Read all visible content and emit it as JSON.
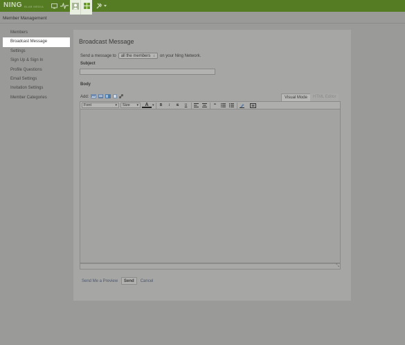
{
  "topbar": {
    "logo": "NING",
    "logo_sub": "BLAB MEDIA",
    "icons": [
      "monitor-icon",
      "activity-icon",
      "member-icon",
      "grid-icon",
      "tools-icon"
    ],
    "accent": "#557c22"
  },
  "subheader": {
    "title": "Member Management"
  },
  "sidebar": {
    "items": [
      {
        "label": "Members"
      },
      {
        "label": "Broadcast Message"
      },
      {
        "label": "Settings"
      },
      {
        "label": "Sign Up & Sign In"
      },
      {
        "label": "Profile Questions"
      },
      {
        "label": "Email Settings"
      },
      {
        "label": "Invitation Settings"
      },
      {
        "label": "Member Categories"
      }
    ],
    "active": "Broadcast Message"
  },
  "main": {
    "title": "Broadcast Message",
    "send_prefix": "Send a message to",
    "recipient_select": "all the members",
    "send_suffix": "on your Ning Network.",
    "subject_label": "Subject",
    "subject_value": "",
    "body_label": "Body",
    "add_label": "Add:",
    "tabs": [
      {
        "label": "Visual Mode",
        "active": true
      },
      {
        "label": "HTML Editor",
        "active": false
      }
    ],
    "toolbar": {
      "font": "Font",
      "size": "Size",
      "text_color": "A",
      "bold": "B",
      "italic": "I",
      "strike": "S",
      "underline": "U"
    },
    "actions": {
      "preview": "Send Me a Preview",
      "send": "Send",
      "cancel": "Cancel"
    }
  }
}
